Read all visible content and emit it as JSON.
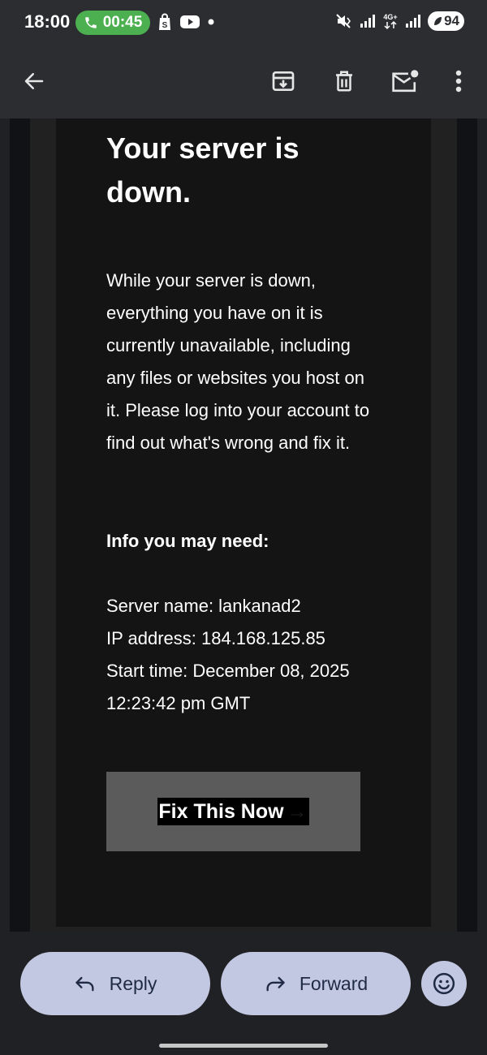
{
  "status_bar": {
    "time": "18:00",
    "call_timer": "00:45",
    "battery": "94"
  },
  "app_bar": {
    "icons": [
      "back-arrow-icon",
      "archive-icon",
      "delete-icon",
      "mark-unread-icon",
      "more-vert-icon"
    ]
  },
  "email": {
    "headline": "Your server is down.",
    "body": "While your server is down, everything you have on it is currently unavailable, including any files or websites you host on it. Please log into your account to find out what's wrong and fix it.",
    "info_heading": "Info you may need:",
    "server_name_line": "Server name: lankanad2",
    "ip_line": "IP address: 184.168.125.85",
    "start_time_line_1": "Start time: December 08, 2025",
    "start_time_line_2": "12:23:42 pm GMT",
    "cta_label": "Fix This Now",
    "cta_arrow": "→"
  },
  "actions": {
    "reply_label": "Reply",
    "forward_label": "Forward"
  },
  "colors": {
    "call_pill": "#4caf50",
    "action_pill": "#c3c8e2",
    "cta_bg": "#5b5b5b"
  }
}
